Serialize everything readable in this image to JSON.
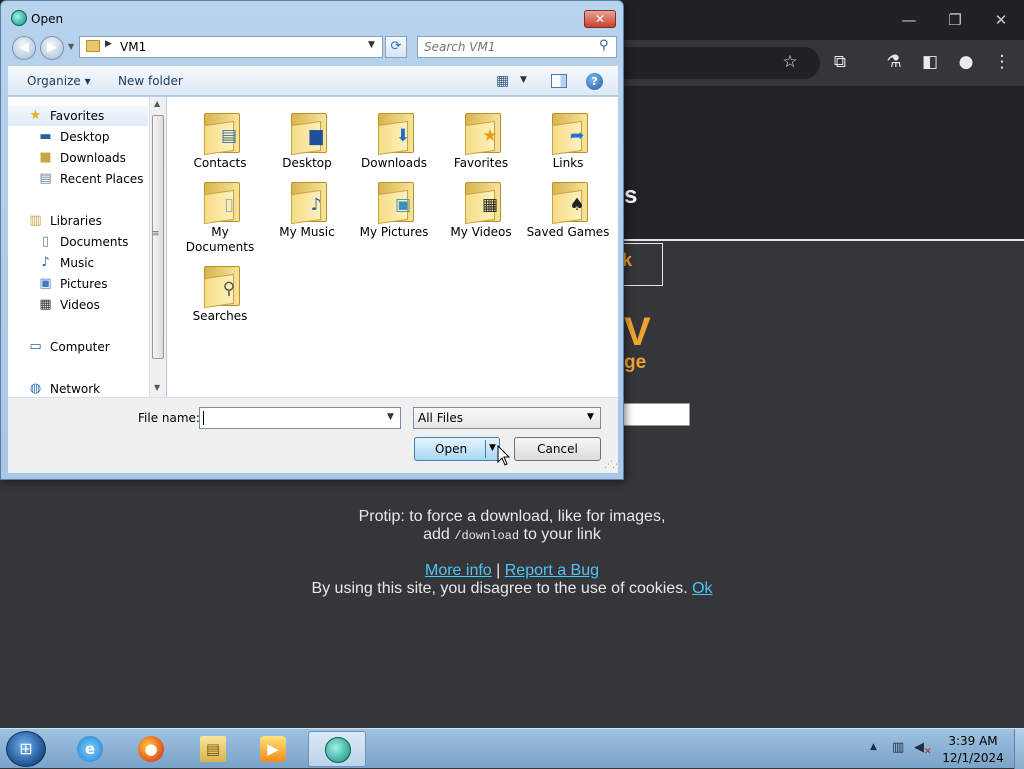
{
  "dialog": {
    "title": "Open",
    "close_glyph": "✕",
    "address": {
      "path": "VM1",
      "separator": "▶"
    },
    "search": {
      "placeholder": "Search VM1"
    },
    "toolbar": {
      "organize": "Organize ▾",
      "new_folder": "New folder"
    },
    "nav_items": [
      {
        "label": "Favorites",
        "icon": "star-icon"
      },
      {
        "label": "Desktop",
        "icon": "desktop-icon"
      },
      {
        "label": "Downloads",
        "icon": "downloads-folder-icon"
      },
      {
        "label": "Recent Places",
        "icon": "recent-places-icon"
      },
      {
        "label": "Libraries",
        "icon": "libraries-icon"
      },
      {
        "label": "Documents",
        "icon": "documents-icon"
      },
      {
        "label": "Music",
        "icon": "music-icon"
      },
      {
        "label": "Pictures",
        "icon": "pictures-icon"
      },
      {
        "label": "Videos",
        "icon": "videos-icon"
      },
      {
        "label": "Computer",
        "icon": "computer-icon"
      },
      {
        "label": "Network",
        "icon": "network-icon"
      }
    ],
    "files": [
      {
        "label": "Contacts",
        "icon": "contacts-folder-icon"
      },
      {
        "label": "Desktop",
        "icon": "desktop-folder-icon"
      },
      {
        "label": "Downloads",
        "icon": "downloads-folder-icon"
      },
      {
        "label": "Favorites",
        "icon": "favorites-folder-icon"
      },
      {
        "label": "Links",
        "icon": "links-folder-icon"
      },
      {
        "label": "My Documents",
        "icon": "documents-folder-icon"
      },
      {
        "label": "My Music",
        "icon": "music-folder-icon"
      },
      {
        "label": "My Pictures",
        "icon": "pictures-folder-icon"
      },
      {
        "label": "My Videos",
        "icon": "videos-folder-icon"
      },
      {
        "label": "Saved Games",
        "icon": "saved-games-folder-icon"
      },
      {
        "label": "Searches",
        "icon": "searches-folder-icon"
      }
    ],
    "filename_label": "File name:",
    "filename_value": "",
    "filetype": "All Files",
    "open_label": "Open",
    "cancel_label": "Cancel"
  },
  "page": {
    "heading_fragment": "s",
    "button_fragment": "k",
    "title_fragment": "V",
    "subtitle_fragment": "ge",
    "protip_1": "Protip: to force a download, like for images,",
    "protip_2a": "add ",
    "protip_code": "/download",
    "protip_2b": " to your link",
    "more_info": "More info",
    "links_sep": " | ",
    "report_bug": "Report a Bug",
    "cookie_text": "By using this site, you disagree to the use of cookies. ",
    "cookie_ok": "Ok"
  },
  "taskbar": {
    "time": "3:39 AM",
    "date": "12/1/2024",
    "apps": [
      "internet-explorer-icon",
      "firefox-icon",
      "file-explorer-icon",
      "media-player-icon",
      "active-app-icon"
    ]
  },
  "colors": {
    "accent": "#f0a330",
    "link": "#4fc3f7",
    "page_bg": "#35363a"
  }
}
